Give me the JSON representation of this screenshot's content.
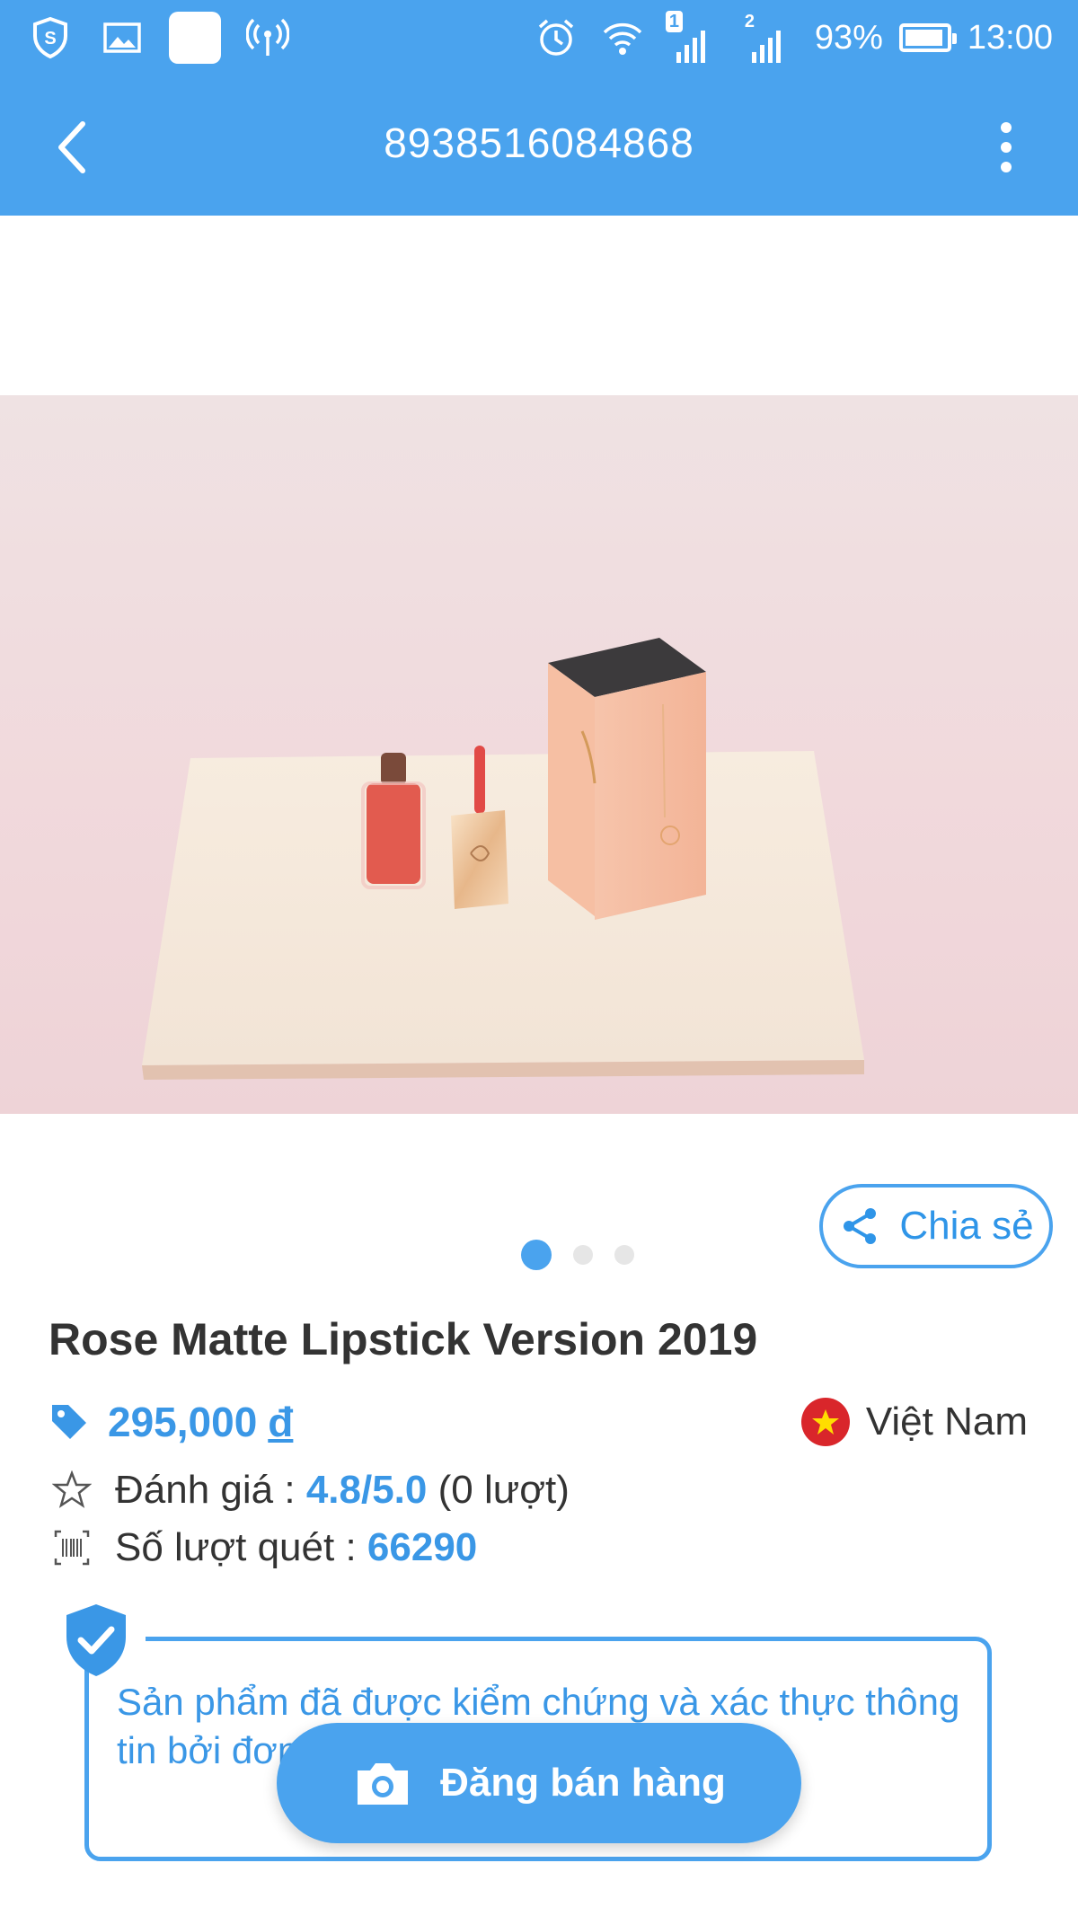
{
  "status_bar": {
    "sim1_label": "1",
    "sim2_label": "2",
    "battery_percent": "93%",
    "battery_level": 0.93,
    "time": "13:00"
  },
  "app_bar": {
    "title": "8938516084868"
  },
  "product": {
    "image_count": 3,
    "active_image": 0,
    "share_label": "Chia sẻ",
    "name": "Rose Matte Lipstick Version 2019",
    "price": "295,000",
    "currency": "đ",
    "origin_country": "Việt Nam",
    "rating_label": "Đánh giá :",
    "rating_value": "4.8/5.0",
    "rating_count": "(0 lượt)",
    "scan_label": "Số lượt quét :",
    "scan_count": "66290"
  },
  "verification": {
    "text": "Sản phẩm đã được kiểm chứng và xác thực thông tin bởi đơn vị sở hữu với iCheck."
  },
  "sell_button": {
    "label": "Đăng bán hàng"
  },
  "colors": {
    "primary": "#4aa3ee",
    "link_blue": "#3a97e6",
    "text_dark": "#333333",
    "flag_red": "#d9262b"
  },
  "icons": {
    "back": "arrow-left",
    "more": "vertical-dots",
    "share": "share-nodes",
    "price_tag": "tag",
    "rating": "star-outline",
    "scan": "barcode",
    "verified": "shield-check",
    "camera": "camera"
  }
}
